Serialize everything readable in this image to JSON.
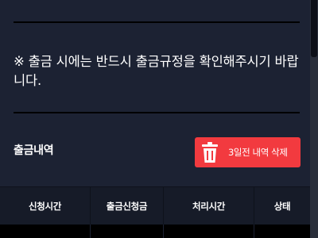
{
  "notice": {
    "text": "※ 출금 시에는 반드시 출금규정을 확인해주시기 바랍니다."
  },
  "history": {
    "title": "출금내역",
    "delete_button_label": "3일전 내역 삭제",
    "delete_icon": "trash-icon",
    "columns": [
      "신청시간",
      "출금신청금",
      "처리시간",
      "상태"
    ],
    "rows": []
  },
  "colors": {
    "background": "#1c2233",
    "delete_button": "#f23a3f",
    "table_header": "#161b28"
  }
}
